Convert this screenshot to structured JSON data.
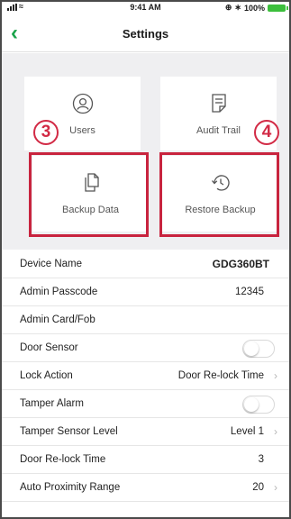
{
  "colors": {
    "accent": "#1aa34a",
    "highlight": "#c8243e",
    "tile_background": "#efeff1",
    "battery": "#3cbf3c"
  },
  "status_bar": {
    "time": "9:41 AM",
    "battery": "100%",
    "icons": [
      "signal-icon",
      "wifi-icon",
      "location-icon",
      "bluetooth-icon",
      "battery-icon"
    ]
  },
  "nav": {
    "title": "Settings",
    "back_icon": "chevron-left-icon"
  },
  "tiles": [
    {
      "label": "Users",
      "icon": "user-icon"
    },
    {
      "label": "Audit Trail",
      "icon": "document-icon"
    },
    {
      "label": "Backup Data",
      "icon": "copy-icon",
      "badge": "3"
    },
    {
      "label": "Restore Backup",
      "icon": "restore-icon",
      "badge": "4"
    }
  ],
  "settings": [
    {
      "label": "Device Name",
      "value": "GDG360BT"
    },
    {
      "label": "Admin Passcode",
      "value": "12345"
    },
    {
      "label": "Admin Card/Fob",
      "value": ""
    },
    {
      "label": "Door Sensor",
      "toggle": false
    },
    {
      "label": "Lock Action",
      "value": "Door Re-lock Time"
    },
    {
      "label": "Tamper Alarm",
      "toggle": false
    },
    {
      "label": "Tamper Sensor Level",
      "value": "Level 1"
    },
    {
      "label": "Door Re-lock Time",
      "value": "3"
    },
    {
      "label": "Auto Proximity Range",
      "value": "20"
    }
  ]
}
